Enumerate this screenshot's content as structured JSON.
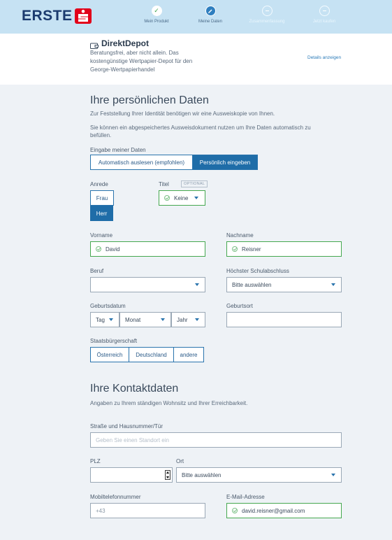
{
  "brand": {
    "name": "ERSTE",
    "accent": "#e2001a",
    "navy": "#1b3b6f"
  },
  "steps": [
    {
      "label": "Mein Produkt",
      "state": "done"
    },
    {
      "label": "Meine Daten",
      "state": "active"
    },
    {
      "label": "Zusammenfassung",
      "state": "todo"
    },
    {
      "label": "Jetzt kaufen",
      "state": "todo"
    }
  ],
  "product": {
    "name": "DirektDepot",
    "description": "Beratungsfrei, aber nicht allein. Das kostengünstige Wertpapier-Depot für den George-Wertpapierhandel",
    "details_link": "Details anzeigen"
  },
  "personal": {
    "heading": "Ihre persönlichen Daten",
    "intro1": "Zur Feststellung Ihrer Identität benötigen wir eine Ausweiskopie von Ihnen.",
    "intro2": "Sie können ein abgespeichertes Ausweisdokument nutzen um Ihre Daten automatisch zu befüllen.",
    "entry_label": "Eingabe meiner Daten",
    "entry_options": [
      "Automatisch auslesen (empfohlen)",
      "Persönlich eingeben"
    ],
    "entry_selected": "Persönlich eingeben",
    "salutation_label": "Anrede",
    "salutation_options": [
      "Frau",
      "Herr"
    ],
    "salutation_selected": "Herr",
    "title_label": "Titel",
    "title_badge": "OPTIONAL",
    "title_value": "Keine",
    "firstname_label": "Vorname",
    "firstname_value": "David",
    "lastname_label": "Nachname",
    "lastname_value": "Reisner",
    "job_label": "Beruf",
    "job_value": "",
    "education_label": "Höchster Schulabschluss",
    "education_value": "Bitte auswählen",
    "birthdate_label": "Geburtsdatum",
    "birth_day": "Tag",
    "birth_month": "Monat",
    "birth_year": "Jahr",
    "birthplace_label": "Geburtsort",
    "birthplace_value": "",
    "citizenship_label": "Staatsbürgerschaft",
    "citizenship_options": [
      "Österreich",
      "Deutschland",
      "andere"
    ]
  },
  "contact": {
    "heading": "Ihre Kontaktdaten",
    "intro": "Angaben zu Ihrem ständigen Wohnsitz und Ihrer Erreichbarkeit.",
    "street_label": "Straße und Hausnummer/Tür",
    "street_placeholder": "Geben Sie einen Standort ein",
    "zip_label": "PLZ",
    "zip_value": "",
    "city_label": "Ort",
    "city_value": "Bitte auswählen",
    "mobile_label": "Mobiltelefonnummer",
    "mobile_value": "+43",
    "email_label": "E-Mail-Adresse",
    "email_value": "david.reisner@gmail.com"
  }
}
